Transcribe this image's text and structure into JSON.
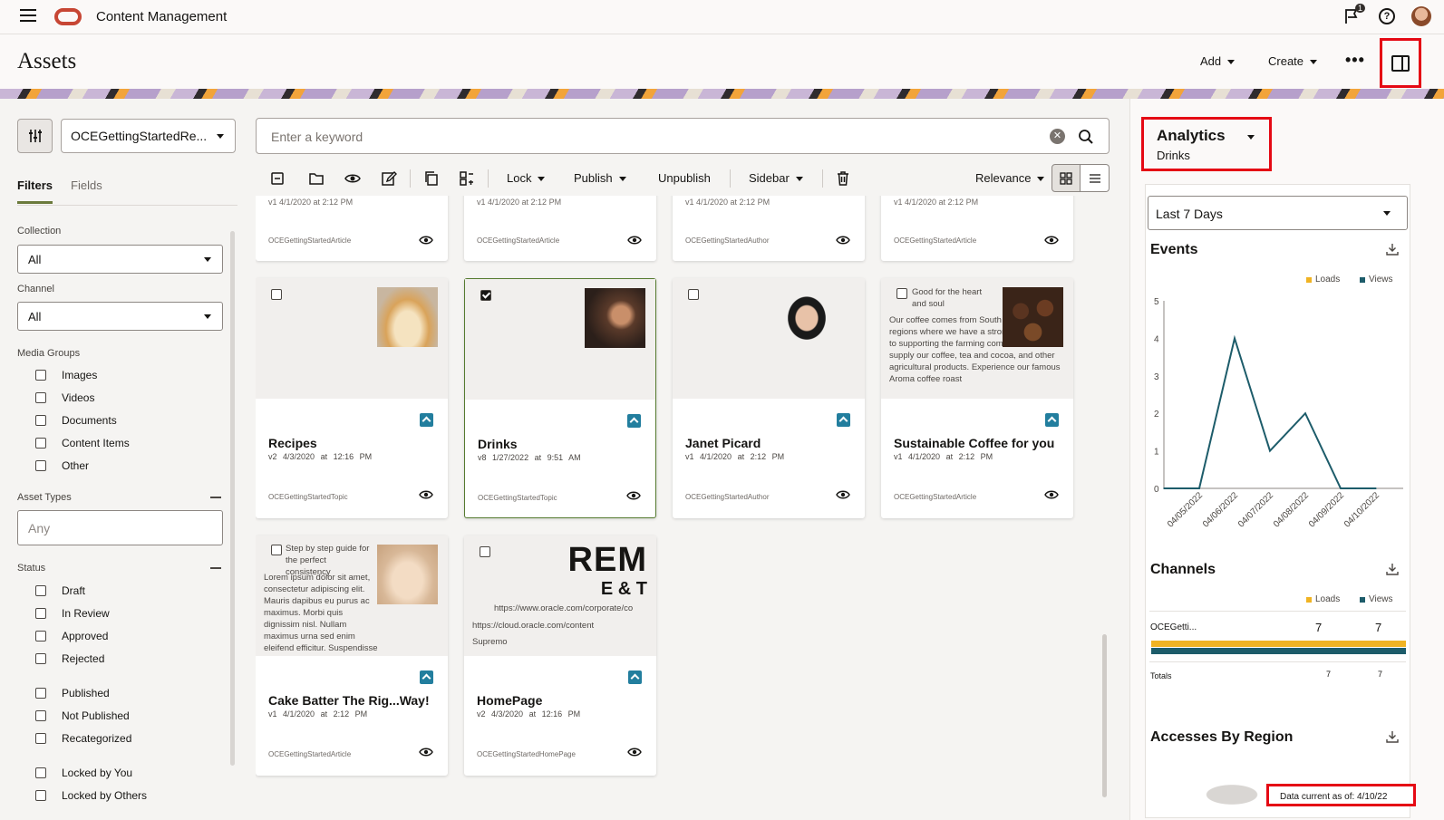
{
  "topbar": {
    "app_title": "Content Management",
    "notification_count": "1",
    "help_label": "?"
  },
  "header": {
    "title": "Assets",
    "add_label": "Add",
    "create_label": "Create",
    "more_label": "•••"
  },
  "filters": {
    "repository": "OCEGettingStartedRe...",
    "tabs": [
      "Filters",
      "Fields"
    ],
    "collection_label": "Collection",
    "collection_value": "All",
    "channel_label": "Channel",
    "channel_value": "All",
    "media_groups_label": "Media Groups",
    "media_groups": [
      "Images",
      "Videos",
      "Documents",
      "Content Items",
      "Other"
    ],
    "asset_types_label": "Asset Types",
    "asset_types_placeholder": "Any",
    "status_label": "Status",
    "status_group1": [
      "Draft",
      "In Review",
      "Approved",
      "Rejected"
    ],
    "status_group2": [
      "Published",
      "Not Published",
      "Recategorized"
    ],
    "status_group3": [
      "Locked by You",
      "Locked by Others"
    ]
  },
  "search": {
    "placeholder": "Enter a keyword"
  },
  "toolbar": {
    "lock": "Lock",
    "publish": "Publish",
    "unpublish": "Unpublish",
    "sidebar": "Sidebar",
    "sort": "Relevance"
  },
  "cards_top": [
    {
      "ctype": "OCEGettingStartedArticle",
      "ver": "v1   4/1/2020 at 2:12 PM"
    },
    {
      "ctype": "OCEGettingStartedArticle",
      "ver": "v1   4/1/2020 at 2:12 PM"
    },
    {
      "ctype": "OCEGettingStartedAuthor",
      "ver": "v1   4/1/2020 at 2:12 PM"
    },
    {
      "ctype": "OCEGettingStartedArticle",
      "ver": "v1   4/1/2020 at 2:12 PM"
    }
  ],
  "cards": [
    {
      "name": "Recipes",
      "ver": "v2",
      "date": "4/3/2020 at 12:16 PM",
      "ctype": "OCEGettingStartedTopic"
    },
    {
      "name": "Drinks",
      "ver": "v8",
      "date": "1/27/2022 at 9:51 AM",
      "ctype": "OCEGettingStartedTopic"
    },
    {
      "name": "Janet Picard",
      "ver": "v1",
      "date": "4/1/2020 at 2:12 PM",
      "ctype": "OCEGettingStartedAuthor"
    },
    {
      "name": "Sustainable Coffee for you",
      "ver": "v1",
      "date": "4/1/2020 at 2:12 PM",
      "ctype": "OCEGettingStartedArticle",
      "snippet_title": "Good for the heart and soul",
      "snippet": "Our coffee comes from South American regions where we have a strong commitment to supporting the farming communities that supply our coffee, tea and cocoa, and other agricultural products. Experience our famous Aroma coffee roast"
    },
    {
      "name": "Cake Batter The Rig...Way!",
      "ver": "v1",
      "date": "4/1/2020 at 2:12 PM",
      "ctype": "OCEGettingStartedArticle",
      "snippet_title": "Step by step guide for the perfect consistency",
      "snippet": "Lorem ipsum dolor sit amet, consectetur adipiscing elit. Mauris dapibus eu purus ac maximus. Morbi quis dignissim nisl. Nullam maximus urna sed enim eleifend efficitur. Suspendisse turpis nulla egestas ligula placerat consequat"
    },
    {
      "name": "HomePage",
      "ver": "v2",
      "date": "4/3/2020 at 12:16 PM",
      "ctype": "OCEGettingStartedHomePage",
      "banner_text": "REM",
      "banner_text2": "E & T",
      "url1": "https://www.oracle.com/corporate/co",
      "url2": "https://cloud.oracle.com/content",
      "brand": "Supremo"
    }
  ],
  "analytics": {
    "title": "Analytics",
    "subtitle": "Drinks",
    "range": "Last 7 Days",
    "events_title": "Events",
    "channels_title": "Channels",
    "regions_title": "Accesses By Region",
    "legend_loads": "Loads",
    "legend_views": "Views",
    "channel_name": "OCEGetti...",
    "channel_loads": "7",
    "channel_views": "7",
    "totals_label": "Totals",
    "totals_loads": "7",
    "totals_views": "7",
    "data_current": "Data current as of: 4/10/22",
    "colors": {
      "loads": "#f0b323",
      "views": "#1d5c6a"
    }
  },
  "chart_data": {
    "type": "line",
    "title": "Events",
    "x": [
      "",
      "04/05/2022",
      "04/06/2022",
      "04/07/2022",
      "04/08/2022",
      "04/09/2022",
      "04/10/2022"
    ],
    "series": [
      {
        "name": "Views",
        "values": [
          0,
          0,
          4,
          1,
          2,
          0,
          0
        ]
      }
    ],
    "ylim": [
      0,
      5
    ],
    "yticks": [
      "0",
      "1",
      "2",
      "3",
      "4",
      "5"
    ]
  }
}
